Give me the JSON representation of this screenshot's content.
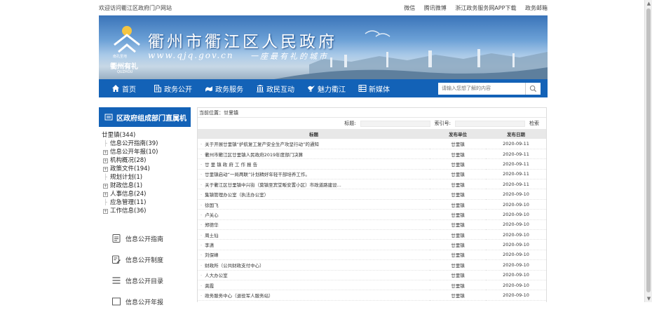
{
  "topbar": {
    "welcome": "欢迎访问衢江区政府门户网站",
    "links": [
      "微信",
      "腾讯微博",
      "浙江政务服务网APP下载",
      "政务邮箱"
    ]
  },
  "banner": {
    "title": "衢州市衢江区人民政府",
    "url": "www.qjq.gov.cn",
    "motto": "一座最有礼的城市",
    "logo_text": "衢州有礼",
    "logo_sub": "QUZHOU",
    "logo_top": "南孔圣地"
  },
  "nav": {
    "items": [
      {
        "label": "首页",
        "icon": "home-icon"
      },
      {
        "label": "政务公开",
        "icon": "building-icon"
      },
      {
        "label": "政务服务",
        "icon": "service-icon"
      },
      {
        "label": "政民互动",
        "icon": "temple-icon"
      },
      {
        "label": "魅力衢江",
        "icon": "crane-icon"
      },
      {
        "label": "新媒体",
        "icon": "media-icon"
      }
    ],
    "search_placeholder": "请输入您想了解的内容"
  },
  "sidebar": {
    "heading": "区政府组成部门直属机",
    "tree": {
      "root": "廿里镇(344)",
      "nodes": [
        {
          "label": "信息公开指南(39)",
          "type": "leaf"
        },
        {
          "label": "信息公开年报(10)",
          "type": "plus"
        },
        {
          "label": "机构概况(28)",
          "type": "plus"
        },
        {
          "label": "政策文件(194)",
          "type": "plus"
        },
        {
          "label": "规划计划(1)",
          "type": "leaf"
        },
        {
          "label": "财政信息(1)",
          "type": "plus"
        },
        {
          "label": "人事信息(24)",
          "type": "plus"
        },
        {
          "label": "应急管理(11)",
          "type": "leaf"
        },
        {
          "label": "工作信息(36)",
          "type": "plus"
        }
      ]
    },
    "buttons": [
      "信息公开指南",
      "信息公开制度",
      "信息公开目录",
      "信息公开年报"
    ]
  },
  "main": {
    "breadcrumb": "当前位置：廿里镇",
    "filter": {
      "title_label": "标题:",
      "index_label": "索引号:",
      "search_label": "检索"
    },
    "columns": [
      "标题",
      "发布单位",
      "发布日期"
    ],
    "rows": [
      {
        "title": "关于开展廿里镇“护航复工复产安全生产攻坚行动”的通知",
        "unit": "廿里镇",
        "date": "2020-09-11"
      },
      {
        "title": "衢州市衢江区廿里镇人民政府2019年度部门决算",
        "unit": "廿里镇",
        "date": "2020-09-11"
      },
      {
        "title": "廿 里 镇 政 府 工 作 报 告",
        "unit": "廿里镇",
        "date": "2020-09-11"
      },
      {
        "title": "廿里镇启动“一局两联”计划精好年轻干部培养工作。",
        "unit": "廿里镇",
        "date": "2020-09-11"
      },
      {
        "title": "关于衢江区廿里镇中兴街（莫镇至宾堂畈安置小区）市政道路建设...",
        "unit": "廿里镇",
        "date": "2020-09-11"
      },
      {
        "title": "集镇管理办公室（执法办公室）",
        "unit": "廿里镇",
        "date": "2020-09-10"
      },
      {
        "title": "徐国飞",
        "unit": "廿里镇",
        "date": "2020-09-10"
      },
      {
        "title": "卢关心",
        "unit": "廿里镇",
        "date": "2020-09-10"
      },
      {
        "title": "郑德华",
        "unit": "廿里镇",
        "date": "2020-09-10"
      },
      {
        "title": "周土仙",
        "unit": "廿里镇",
        "date": "2020-09-10"
      },
      {
        "title": "李潇",
        "unit": "廿里镇",
        "date": "2020-09-10"
      },
      {
        "title": "刘保峰",
        "unit": "廿里镇",
        "date": "2020-09-10"
      },
      {
        "title": "财政所（公共财政支付中心）",
        "unit": "廿里镇",
        "date": "2020-09-10"
      },
      {
        "title": "人大办公室",
        "unit": "廿里镇",
        "date": "2020-09-10"
      },
      {
        "title": "龚霞",
        "unit": "廿里镇",
        "date": "2020-09-10"
      },
      {
        "title": "政务服务中心（退役军人服务站）",
        "unit": "廿里镇",
        "date": "2020-09-10"
      }
    ]
  },
  "colors": {
    "brand_blue": "#1362b7",
    "header_gray": "#e8e8e8"
  }
}
